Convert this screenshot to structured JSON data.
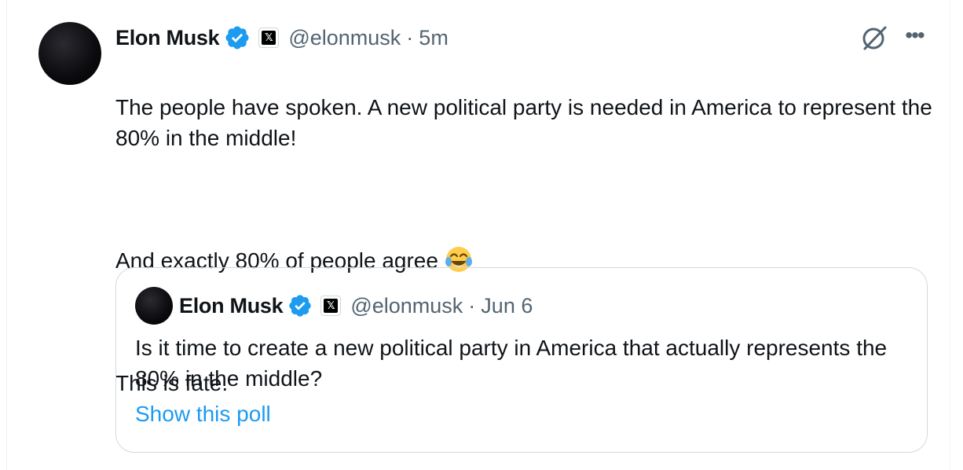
{
  "tweet": {
    "author_name": "Elon Musk",
    "handle": "@elonmusk",
    "separator": "·",
    "time": "5m",
    "text_line1": "The people have spoken. A new political party is needed in America to represent the 80% in the middle!",
    "text_line2": "And exactly 80% of people agree",
    "text_line3": "This is fate.",
    "emoji": "face-with-tears-of-joy",
    "x_badge": "𝕏"
  },
  "quoted_tweet": {
    "author_name": "Elon Musk",
    "handle": "@elonmusk",
    "separator": "·",
    "date": "Jun 6",
    "text": "Is it time to create a new political party in America that actually represents the 80% in the middle?",
    "show_poll_label": "Show this poll",
    "x_badge": "𝕏"
  },
  "colors": {
    "verified_blue": "#1d9bf0",
    "secondary_text": "#536471",
    "link": "#1d9bf0"
  },
  "icons": {
    "grok": "grok-icon",
    "more": "more-icon"
  }
}
